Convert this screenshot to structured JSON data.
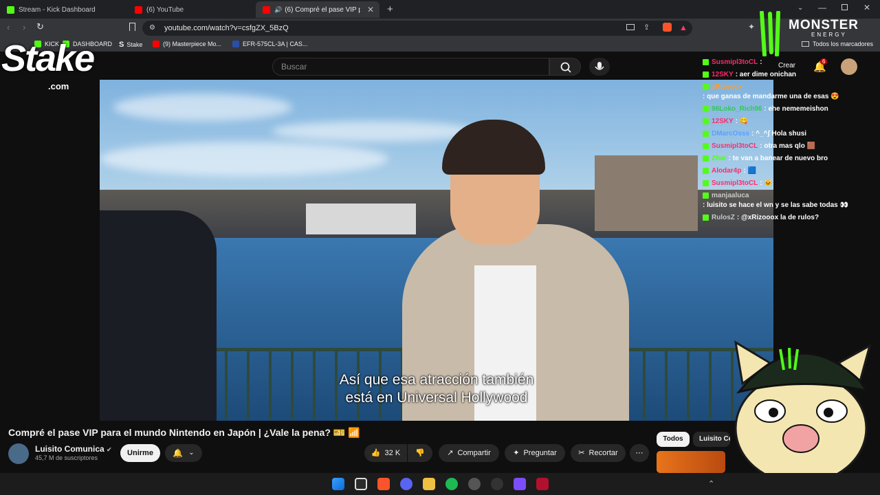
{
  "tabs": [
    {
      "label": "Stream - Kick Dashboard",
      "color": "#53fc18"
    },
    {
      "label": "(6) YouTube",
      "color": "#ff0000"
    },
    {
      "label": "(6) Compré el pase VIP para el",
      "color": "#ff0000"
    }
  ],
  "url": "youtube.com/watch?v=csfgZX_5BzQ",
  "bookmarks": [
    {
      "label": "KICK",
      "color": "#53fc18"
    },
    {
      "label": "DASHBOARD",
      "color": "#53fc18"
    },
    {
      "label": "Stake",
      "color": "#ffffff"
    },
    {
      "label": "(9) Masterpiece Mo...",
      "color": "#ff0000"
    },
    {
      "label": "EFR-575CL-3A | CAS...",
      "color": "#2a4ea8"
    }
  ],
  "all_bookmarks": "Todos los marcadores",
  "search_placeholder": "Buscar",
  "create_label": "Crear",
  "notif_count": "6",
  "overlay": {
    "stake": "Stake",
    "stake_com": ".com",
    "monster": "MONSTER",
    "energy": "ENERGY"
  },
  "subtitle": {
    "line1": "Así que esa atracción también",
    "line2": "está en Universal Hollywood"
  },
  "chat": [
    {
      "user": "Susmipl3toCL",
      "text": ":",
      "color": "#ff2a6d"
    },
    {
      "user": "12SKY",
      "text": ": aer dime onichan",
      "color": "#ff2a6d"
    },
    {
      "user": "xRizooox",
      "text": ": que ganas de mandarme una de esas 😍",
      "color": "#ff9d2e"
    },
    {
      "user": "96Loko_Rich96",
      "text": ": ehe nememeishon",
      "color": "#34c759"
    },
    {
      "user": "12SKY",
      "text": ": 😋",
      "color": "#ff2a6d"
    },
    {
      "user": "DMarcOsss",
      "text": ": ^_^ʃ Hola shusi",
      "color": "#5aa0ff"
    },
    {
      "user": "Susmipl3toCL",
      "text": ": otra mas qlo 🟫",
      "color": "#ff2a6d"
    },
    {
      "user": "Zhar",
      "text": ": te van a banear de nuevo bro",
      "color": "#53fc18"
    },
    {
      "user": "Alodar4p",
      "text": ": 🟦",
      "color": "#ff2a6d"
    },
    {
      "user": "Susmipl3toCL",
      "text": ": 🐱",
      "color": "#ff2a6d"
    },
    {
      "user": "manjaaluca",
      "text": ": luisito se hace el wn y se las sabe todas 👀",
      "color": "#c8c8c8"
    },
    {
      "user": "RulosZ",
      "text": ": @xRizooox la de rulos?",
      "color": "#c8c8c8"
    }
  ],
  "video_title": "Compré el pase VIP para el mundo Nintendo en Japón | ¿Vale la pena? 🎫 📶",
  "channel": {
    "name": "Luisito Comunica",
    "subscribers": "45,7 M de suscriptores",
    "join_label": "Unirme"
  },
  "actions": {
    "likes": "32 K",
    "share": "Compartir",
    "ask": "Preguntar",
    "clip": "Recortar"
  },
  "chips": {
    "all": "Todos",
    "channel": "Luisito Co"
  }
}
